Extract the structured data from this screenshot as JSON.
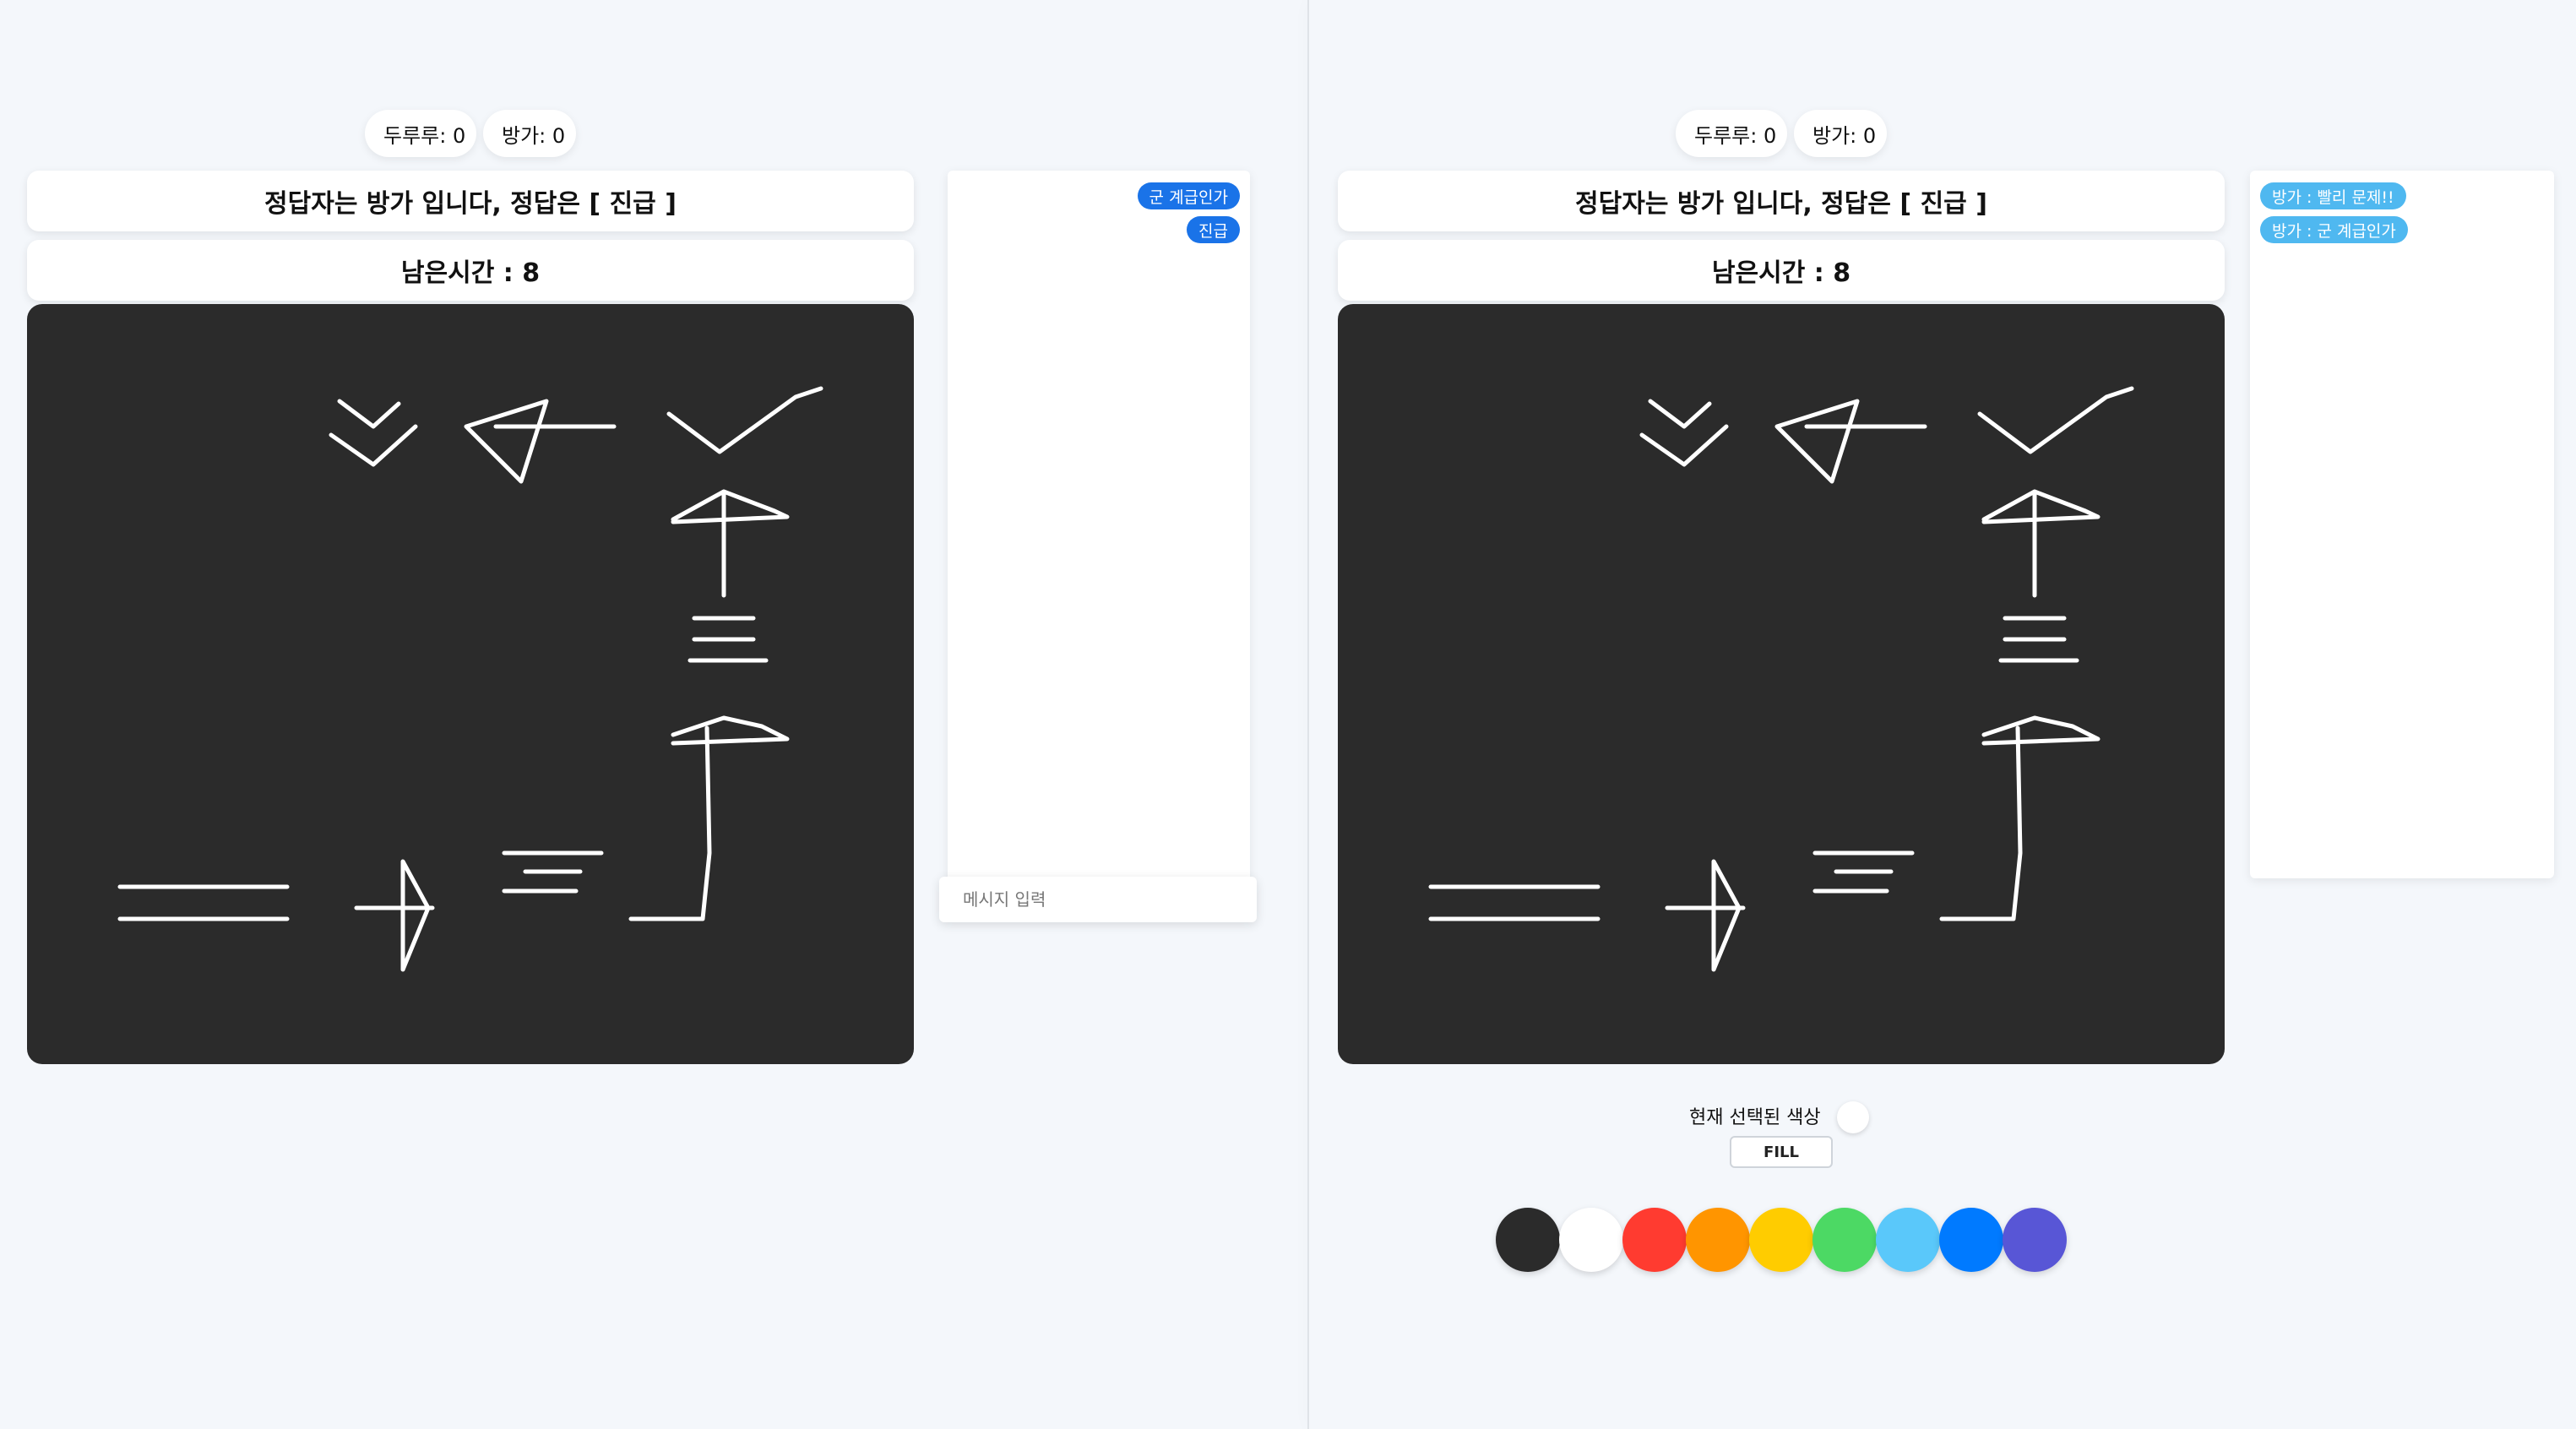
{
  "left_view": {
    "scores": [
      {
        "label": "두루루: 0"
      },
      {
        "label": "방가: 0"
      }
    ],
    "answer_banner": "정답자는 방가 입니다, 정답은 [ 진급 ]",
    "timer": "남은시간 : 8",
    "chat": {
      "messages": [
        {
          "text": "군 계급인가"
        },
        {
          "text": "진급"
        }
      ],
      "input_placeholder": "메시지 입력"
    }
  },
  "right_view": {
    "scores": [
      {
        "label": "두루루: 0"
      },
      {
        "label": "방가: 0"
      }
    ],
    "answer_banner": "정답자는 방가 입니다, 정답은 [ 진급 ]",
    "timer": "남은시간 : 8",
    "chat": {
      "messages": [
        {
          "text": "방가 : 빨리 문제!!"
        },
        {
          "text": "방가 : 군 계급인가"
        }
      ]
    },
    "toolbar": {
      "current_color_label": "현재 선택된 색상",
      "current_color": "#ffffff",
      "fill_label": "FILL"
    },
    "palette": [
      {
        "name": "black",
        "color": "#2b2b2b"
      },
      {
        "name": "white",
        "color": "#ffffff"
      },
      {
        "name": "red",
        "color": "#ff3b30"
      },
      {
        "name": "orange",
        "color": "#ff9500"
      },
      {
        "name": "yellow",
        "color": "#ffcc00"
      },
      {
        "name": "green",
        "color": "#4cd964"
      },
      {
        "name": "light-blue",
        "color": "#5ac8fa"
      },
      {
        "name": "blue",
        "color": "#007aff"
      },
      {
        "name": "purple",
        "color": "#5856d6"
      }
    ]
  },
  "colors": {
    "canvas_background": "#2b2b2b",
    "stroke": "#ffffff",
    "chat_bubble_dark": "#1a73e8",
    "chat_bubble_light": "#4fb8f0",
    "page_background": "#f4f7fb"
  }
}
